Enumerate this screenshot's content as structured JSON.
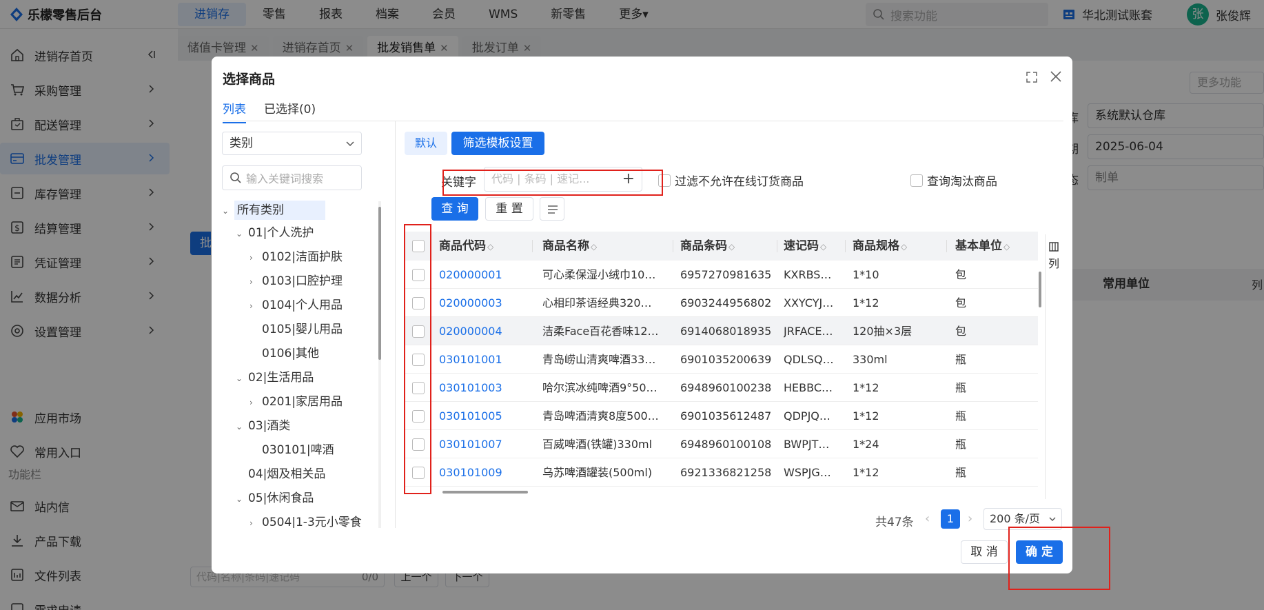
{
  "app": {
    "title": "乐檬零售后台"
  },
  "topnav": [
    "进销存",
    "零售",
    "报表",
    "档案",
    "会员",
    "WMS",
    "新零售",
    "更多▾"
  ],
  "search": {
    "placeholder": "搜索功能"
  },
  "account": {
    "name": "华北测试账套"
  },
  "user": {
    "avatar_letter": "张",
    "name": "张俊辉"
  },
  "sidebar": {
    "items": [
      {
        "label": "进销存首页",
        "icon": "home-icon"
      },
      {
        "label": "采购管理",
        "icon": "cart-icon"
      },
      {
        "label": "配送管理",
        "icon": "box-icon"
      },
      {
        "label": "批发管理",
        "icon": "card-icon"
      },
      {
        "label": "库存管理",
        "icon": "minus-box-icon"
      },
      {
        "label": "结算管理",
        "icon": "dollar-icon"
      },
      {
        "label": "凭证管理",
        "icon": "doc-icon"
      },
      {
        "label": "数据分析",
        "icon": "chart-icon"
      },
      {
        "label": "设置管理",
        "icon": "gear-icon"
      }
    ],
    "extra": [
      {
        "label": "应用市场",
        "icon": "apps-icon"
      },
      {
        "label": "常用入口",
        "icon": "heart-icon"
      }
    ],
    "section_label": "功能栏",
    "tools": [
      {
        "label": "站内信",
        "icon": "mail-icon"
      },
      {
        "label": "产品下载",
        "icon": "download-icon"
      },
      {
        "label": "文件列表",
        "icon": "list-icon"
      },
      {
        "label": "需求申请",
        "icon": "request-icon"
      }
    ]
  },
  "page_tabs": [
    {
      "label": "储值卡管理"
    },
    {
      "label": "进销存首页"
    },
    {
      "label": "批发销售单",
      "active": true
    },
    {
      "label": "批发订单"
    }
  ],
  "background": {
    "more_label": "更多功能",
    "warehouse_label": "库",
    "warehouse": "系统默认仓库",
    "date_label": "期",
    "date": "2025-06-04",
    "status_label": "态",
    "status": "制单",
    "col_unit": "常用单位",
    "col_label": "列",
    "batch_btn": "批",
    "search_placeholder": "代码|名称|条码|速记码",
    "search_count": "0/0",
    "prev_btn": "上一个",
    "next_btn": "下一个"
  },
  "modal": {
    "title": "选择商品",
    "tabs": [
      "列表",
      "已选择(0)"
    ],
    "category_select": "类别",
    "category_search_placeholder": "输入关键词搜索",
    "tree": [
      {
        "label": "所有类别",
        "level": 0,
        "toggle": "⌄"
      },
      {
        "label": "01|个人洗护",
        "level": 1,
        "toggle": "⌄"
      },
      {
        "label": "0102|洁面护肤",
        "level": 2,
        "toggle": "›"
      },
      {
        "label": "0103|口腔护理",
        "level": 2,
        "toggle": "›"
      },
      {
        "label": "0104|个人用品",
        "level": 2,
        "toggle": "›"
      },
      {
        "label": "0105|婴儿用品",
        "level": 2,
        "toggle": ""
      },
      {
        "label": "0106|其他",
        "level": 2,
        "toggle": ""
      },
      {
        "label": "02|生活用品",
        "level": 1,
        "toggle": "⌄"
      },
      {
        "label": "0201|家居用品",
        "level": 2,
        "toggle": "›"
      },
      {
        "label": "03|酒类",
        "level": 1,
        "toggle": "⌄"
      },
      {
        "label": "030101|啤酒",
        "level": 2,
        "toggle": ""
      },
      {
        "label": "04|烟及相关品",
        "level": 1,
        "toggle": ""
      },
      {
        "label": "05|休闲食品",
        "level": 1,
        "toggle": "⌄"
      },
      {
        "label": "0504|1-3元小零食",
        "level": 2,
        "toggle": "›"
      }
    ],
    "filter": {
      "default_btn": "默认",
      "template_btn": "筛选模板设置",
      "keyword_label": "关键字",
      "keyword_placeholder": "代码 | 条码 | 速记...",
      "opt_filter_online": "过滤不允许在线订货商品",
      "opt_query_obsolete": "查询淘汰商品",
      "query_btn": "查 询",
      "reset_btn": "重 置"
    },
    "table": {
      "columns": [
        "商品代码",
        "商品名称",
        "商品条码",
        "速记码",
        "商品规格",
        "基本单位"
      ],
      "col_settings_label": "列",
      "rows": [
        {
          "code": "020000001",
          "name": "可心柔保湿小绒巾10…",
          "barcode": "6957270981635",
          "shortcode": "KXRBS…",
          "spec": "1*10",
          "unit": "包"
        },
        {
          "code": "020000003",
          "name": "心相印茶语经典320…",
          "barcode": "6903244956802",
          "shortcode": "XXYCYJ…",
          "spec": "1*12",
          "unit": "包"
        },
        {
          "code": "020000004",
          "name": "洁柔Face百花香味12…",
          "barcode": "6914068018935",
          "shortcode": "JRFACE…",
          "spec": "120抽×3层",
          "unit": "包"
        },
        {
          "code": "030101001",
          "name": "青岛崂山清爽啤酒33…",
          "barcode": "6901035200639",
          "shortcode": "QDLSQ…",
          "spec": "330ml",
          "unit": "瓶"
        },
        {
          "code": "030101003",
          "name": "哈尔滨冰纯啤酒9°50…",
          "barcode": "6948960100238",
          "shortcode": "HEBBC…",
          "spec": "1*12",
          "unit": "瓶"
        },
        {
          "code": "030101005",
          "name": "青岛啤酒清爽8度500…",
          "barcode": "6901035612487",
          "shortcode": "QDPJQ…",
          "spec": "1*12",
          "unit": "瓶"
        },
        {
          "code": "030101007",
          "name": "百威啤酒(铁罐)330ml",
          "barcode": "6948960100108",
          "shortcode": "BWPJT…",
          "spec": "1*24",
          "unit": "瓶"
        },
        {
          "code": "030101009",
          "name": "乌苏啤酒罐装(500ml)",
          "barcode": "6921336821258",
          "shortcode": "WSPJG…",
          "spec": "1*12",
          "unit": "瓶"
        }
      ]
    },
    "pagination": {
      "total": "共47条",
      "prev": "‹",
      "current": "1",
      "next": "›",
      "page_size": "200 条/页"
    },
    "cancel_btn": "取 消",
    "ok_btn": "确 定"
  },
  "colors": {
    "accent": "#1a6fe8",
    "annotation": "#e0211b",
    "avatar": "#19b48f"
  }
}
